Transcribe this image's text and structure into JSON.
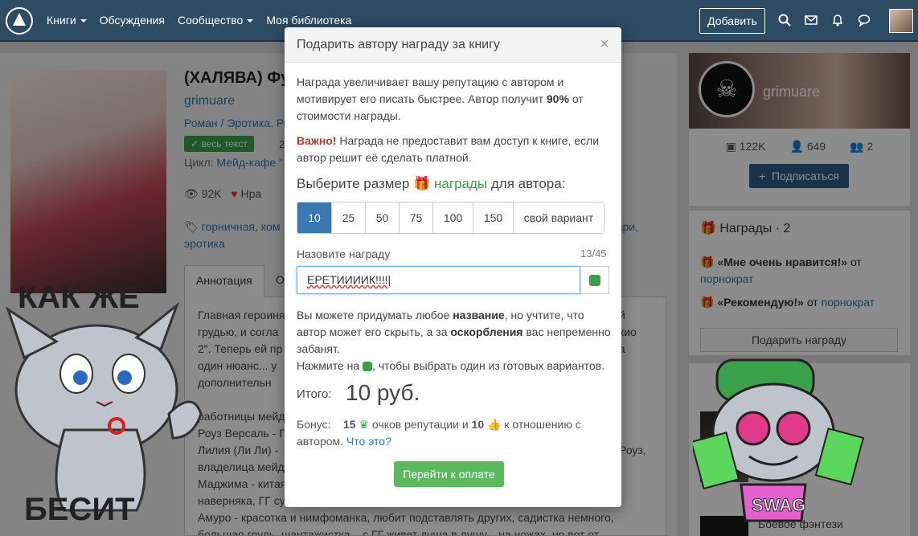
{
  "nav": {
    "links": [
      "Книги",
      "Обсуждения",
      "Сообщество",
      "Моя библиотека"
    ],
    "add_label": "Добавить"
  },
  "book": {
    "title": "(ХАЛЯВА) Фу",
    "author": "grimuare",
    "genre": "Роман / Эротика, Ро",
    "badge": "весь текст",
    "badge_num": "2",
    "cycle_label": "Цикл:",
    "cycle_value": "Мейд-кафе \"",
    "views": "92K",
    "likes": "Нра",
    "tags_line1": "горничная, ком",
    "tags_line1_end": "нари,",
    "tags_line2": "эротика",
    "tab_annotation": "Аннотация",
    "tab_other": "О",
    "annotation_lines": [
      "Главная героиня",
      "грудью, и согла",
      "2\". Теперь ей пр",
      "один нюанс... у",
      "дополнительн",
      "",
      "работницы мейд",
      "Роуз Версаль - Г",
      "Лилия (Ли Ли) -",
      "владелица мейд-",
      "Маджима - китая",
      "наверняка, ГГ су",
      "Амуро - красотка и нимфоманка, любит подставлять других, садистка немного,",
      "большая грудь, шантажистка... с ГГ живет душа в душу... на ножах, но вот от"
    ],
    "annotation_right": [
      "й",
      "кио",
      "а",
      "Роуз,"
    ]
  },
  "author_card": {
    "name": "grimuare",
    "stat1": "122K",
    "stat2": "649",
    "stat3": "2",
    "subscribe": "Подписаться"
  },
  "awards": {
    "title": "Награды",
    "count": "2",
    "a1_text": "«Мне очень нравится!»",
    "a1_from": "от",
    "a1_user": "порнократ",
    "a2_text": "«Рекомендую!»",
    "a2_from": "от",
    "a2_user": "порнократ",
    "give_label": "Подарить награду"
  },
  "bottom_card": {
    "text": "Боевое фэнтези"
  },
  "modal": {
    "title": "Подарить автору награду за книгу",
    "close": "×",
    "p1_a": "Награда увеличивает вашу репутацию с автором и мотивирует его писать быстрее. Автор получит",
    "p1_b": "90%",
    "p1_c": "от стоимости награды.",
    "p2_a": "Важно!",
    "p2_b": "Награда не предоставит вам доступ к книге, если автор решит её сделать платной.",
    "choose_a": "Выберите размер",
    "choose_b": "награды",
    "choose_c": "для автора:",
    "amounts": [
      "10",
      "25",
      "50",
      "75",
      "100",
      "150",
      "свой вариант"
    ],
    "selected_amount": "10",
    "name_label": "Назовите награду",
    "name_count": "13/45",
    "name_value": "ЕРЕТИИИИК!!!!",
    "p3_a": "Вы можете придумать любое",
    "p3_b": "название",
    "p3_c": ", но учтите, что автор может его скрыть, а за",
    "p3_d": "оскорбления",
    "p3_e": "вас непременно забанят.",
    "p4_a": "Нажмите на",
    "p4_b": ", чтобы выбрать один из готовых вариантов.",
    "total_label": "Итого:",
    "total_value": "10 руб.",
    "bonus_label": "Бонус:",
    "bonus_rep": "15",
    "bonus_rep_text": "очков репутации и",
    "bonus_like": "10",
    "bonus_like_text": "к отношению с автором.",
    "bonus_link": "Что это?",
    "pay_label": "Перейти к оплате"
  },
  "stickers": {
    "left_top": "КАК ЖЕ",
    "left_bottom": "БЕСИТ",
    "right_text": "SWAG"
  }
}
